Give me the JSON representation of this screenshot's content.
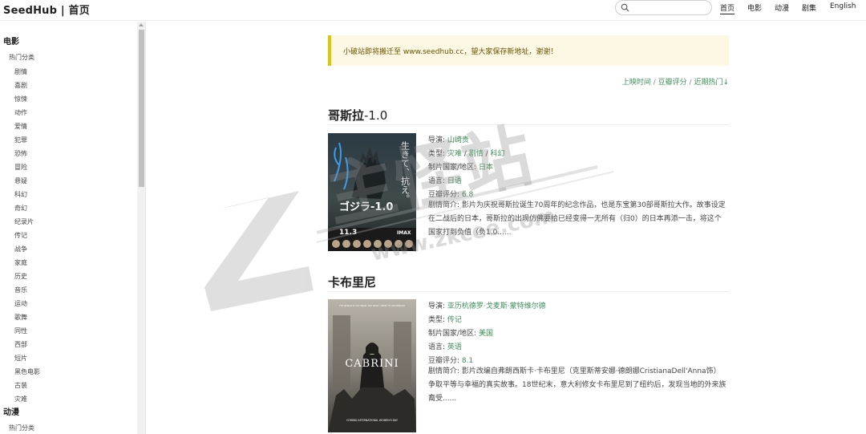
{
  "header": {
    "brand": "SeedHub | 首页",
    "search_placeholder": "",
    "nav": [
      "首页",
      "电影",
      "动漫",
      "剧集",
      "English"
    ]
  },
  "sidebar": {
    "sections": [
      {
        "title": "电影",
        "sub": "热门分类",
        "items": [
          "剧情",
          "喜剧",
          "惊悚",
          "动作",
          "爱情",
          "犯罪",
          "恐怖",
          "冒险",
          "悬疑",
          "科幻",
          "奇幻",
          "纪录片",
          "传记",
          "战争",
          "家庭",
          "历史",
          "音乐",
          "运动",
          "歌舞",
          "同性",
          "西部",
          "短片",
          "黑色电影",
          "古装",
          "灾难"
        ]
      },
      {
        "title": "动漫",
        "sub": "热门分类",
        "items": []
      }
    ]
  },
  "notice": "小破站即将搬迁至 www.seedhub.cc，望大家保存新地址，谢谢！",
  "sort": {
    "release": "上映时间",
    "douban": "豆瓣评分",
    "hot": "近期热门↓",
    "sep": " / "
  },
  "movies": [
    {
      "title": "哥斯拉",
      "title_suffix": "-1.0",
      "director_label": "导演: ",
      "director": "山崎贵",
      "genre_label": "类型: ",
      "genres": [
        "灾难",
        "剧情",
        "科幻"
      ],
      "country_label": "制片国家/地区: ",
      "country": "日本",
      "language_label": "语言: ",
      "language": "日语",
      "score_label": "豆瓣评分: ",
      "score": "6.8",
      "desc": "剧情简介: 影片为庆祝哥斯拉诞生70周年的纪念作品，也是东宝第30部哥斯拉大作。故事设定在二战后的日本，哥斯拉的出现仿佛要给已经变得一无所有（归0）的日本再添一击，将这个国家打到负值（负1.0......",
      "poster": {
        "tagline": "生きて、抗え。",
        "title": "ゴジラ-1.0",
        "date": "11.3",
        "format": "IMAX"
      }
    },
    {
      "title": "卡布里尼",
      "title_suffix": "",
      "director_label": "导演: ",
      "director": "亚历杭德罗·戈麦斯·蒙特维尔德",
      "genre_label": "类型: ",
      "genres": [
        "传记"
      ],
      "country_label": "制片国家/地区: ",
      "country": "美国",
      "language_label": "语言: ",
      "language": "英语",
      "score_label": "豆瓣评分: ",
      "score": "8.1",
      "desc": "剧情简介: 影片改编自弗朗西斯卡·卡布里尼（克里斯蒂安娜·德朗娜CristianaDell'Anna饰）争取平等与幸福的真实故事。18世纪末，意大利修女卡布里尼到了纽约后，发现当地的外来族裔受......",
      "poster": {
        "tagline": "THE WORLD IS TOO SMALL FOR WHAT I WANT TO ACCOMPLISH",
        "title": "CABRINI",
        "footer": "COMING INTERNATIONAL WOMEN'S DAY"
      }
    }
  ],
  "watermark": {
    "brand": "主怪站",
    "url": "www.zkcee.com"
  },
  "colors": {
    "link_green": "#3e8e5a",
    "notice_bg": "#fcf8e3",
    "notice_border": "#e6c300"
  }
}
